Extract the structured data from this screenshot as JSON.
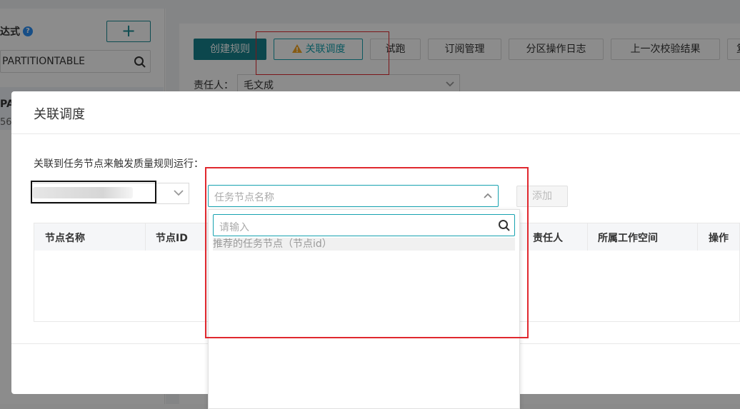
{
  "left_panel": {
    "title": "达式",
    "help_icon": "question-circle-icon",
    "add_label": "+",
    "search_value": "PARTITIONTABLE",
    "item_title": "PA",
    "item_sub": "56"
  },
  "toolbar": {
    "create_label": "创建规则",
    "link_label": "关联调度",
    "trial_label": "试跑",
    "subscribe_label": "订阅管理",
    "partition_log_label": "分区操作日志",
    "last_check_label": "上一次校验结果",
    "more_label": "复"
  },
  "owner": {
    "label": "责任人：",
    "value": "毛文成"
  },
  "modal": {
    "title": "关联调度",
    "description": "关联到任务节点来触发质量规则运行：",
    "node_select_placeholder": "任务节点名称",
    "add_label": "添加",
    "columns": [
      "节点名称",
      "节点ID",
      "责任人",
      "所属工作空间",
      "操作"
    ]
  },
  "dropdown": {
    "search_placeholder": "请输入",
    "group_label": "推荐的任务节点（节点id）"
  },
  "colors": {
    "primary": "#17818c",
    "accent": "#17a2b0",
    "highlight_red": "#e0282e",
    "warning": "#f5a623"
  }
}
